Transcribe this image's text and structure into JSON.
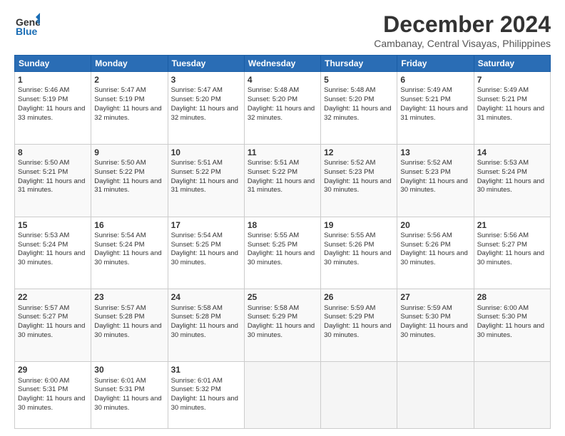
{
  "header": {
    "logo_line1": "General",
    "logo_line2": "Blue",
    "title": "December 2024",
    "subtitle": "Cambanay, Central Visayas, Philippines"
  },
  "days_of_week": [
    "Sunday",
    "Monday",
    "Tuesday",
    "Wednesday",
    "Thursday",
    "Friday",
    "Saturday"
  ],
  "weeks": [
    [
      {
        "day": 1,
        "sunrise": "5:46 AM",
        "sunset": "5:19 PM",
        "daylight": "11 hours and 33 minutes."
      },
      {
        "day": 2,
        "sunrise": "5:47 AM",
        "sunset": "5:19 PM",
        "daylight": "11 hours and 32 minutes."
      },
      {
        "day": 3,
        "sunrise": "5:47 AM",
        "sunset": "5:20 PM",
        "daylight": "11 hours and 32 minutes."
      },
      {
        "day": 4,
        "sunrise": "5:48 AM",
        "sunset": "5:20 PM",
        "daylight": "11 hours and 32 minutes."
      },
      {
        "day": 5,
        "sunrise": "5:48 AM",
        "sunset": "5:20 PM",
        "daylight": "11 hours and 32 minutes."
      },
      {
        "day": 6,
        "sunrise": "5:49 AM",
        "sunset": "5:21 PM",
        "daylight": "11 hours and 31 minutes."
      },
      {
        "day": 7,
        "sunrise": "5:49 AM",
        "sunset": "5:21 PM",
        "daylight": "11 hours and 31 minutes."
      }
    ],
    [
      {
        "day": 8,
        "sunrise": "5:50 AM",
        "sunset": "5:21 PM",
        "daylight": "11 hours and 31 minutes."
      },
      {
        "day": 9,
        "sunrise": "5:50 AM",
        "sunset": "5:22 PM",
        "daylight": "11 hours and 31 minutes."
      },
      {
        "day": 10,
        "sunrise": "5:51 AM",
        "sunset": "5:22 PM",
        "daylight": "11 hours and 31 minutes."
      },
      {
        "day": 11,
        "sunrise": "5:51 AM",
        "sunset": "5:22 PM",
        "daylight": "11 hours and 31 minutes."
      },
      {
        "day": 12,
        "sunrise": "5:52 AM",
        "sunset": "5:23 PM",
        "daylight": "11 hours and 30 minutes."
      },
      {
        "day": 13,
        "sunrise": "5:52 AM",
        "sunset": "5:23 PM",
        "daylight": "11 hours and 30 minutes."
      },
      {
        "day": 14,
        "sunrise": "5:53 AM",
        "sunset": "5:24 PM",
        "daylight": "11 hours and 30 minutes."
      }
    ],
    [
      {
        "day": 15,
        "sunrise": "5:53 AM",
        "sunset": "5:24 PM",
        "daylight": "11 hours and 30 minutes."
      },
      {
        "day": 16,
        "sunrise": "5:54 AM",
        "sunset": "5:24 PM",
        "daylight": "11 hours and 30 minutes."
      },
      {
        "day": 17,
        "sunrise": "5:54 AM",
        "sunset": "5:25 PM",
        "daylight": "11 hours and 30 minutes."
      },
      {
        "day": 18,
        "sunrise": "5:55 AM",
        "sunset": "5:25 PM",
        "daylight": "11 hours and 30 minutes."
      },
      {
        "day": 19,
        "sunrise": "5:55 AM",
        "sunset": "5:26 PM",
        "daylight": "11 hours and 30 minutes."
      },
      {
        "day": 20,
        "sunrise": "5:56 AM",
        "sunset": "5:26 PM",
        "daylight": "11 hours and 30 minutes."
      },
      {
        "day": 21,
        "sunrise": "5:56 AM",
        "sunset": "5:27 PM",
        "daylight": "11 hours and 30 minutes."
      }
    ],
    [
      {
        "day": 22,
        "sunrise": "5:57 AM",
        "sunset": "5:27 PM",
        "daylight": "11 hours and 30 minutes."
      },
      {
        "day": 23,
        "sunrise": "5:57 AM",
        "sunset": "5:28 PM",
        "daylight": "11 hours and 30 minutes."
      },
      {
        "day": 24,
        "sunrise": "5:58 AM",
        "sunset": "5:28 PM",
        "daylight": "11 hours and 30 minutes."
      },
      {
        "day": 25,
        "sunrise": "5:58 AM",
        "sunset": "5:29 PM",
        "daylight": "11 hours and 30 minutes."
      },
      {
        "day": 26,
        "sunrise": "5:59 AM",
        "sunset": "5:29 PM",
        "daylight": "11 hours and 30 minutes."
      },
      {
        "day": 27,
        "sunrise": "5:59 AM",
        "sunset": "5:30 PM",
        "daylight": "11 hours and 30 minutes."
      },
      {
        "day": 28,
        "sunrise": "6:00 AM",
        "sunset": "5:30 PM",
        "daylight": "11 hours and 30 minutes."
      }
    ],
    [
      {
        "day": 29,
        "sunrise": "6:00 AM",
        "sunset": "5:31 PM",
        "daylight": "11 hours and 30 minutes."
      },
      {
        "day": 30,
        "sunrise": "6:01 AM",
        "sunset": "5:31 PM",
        "daylight": "11 hours and 30 minutes."
      },
      {
        "day": 31,
        "sunrise": "6:01 AM",
        "sunset": "5:32 PM",
        "daylight": "11 hours and 30 minutes."
      },
      null,
      null,
      null,
      null
    ]
  ]
}
